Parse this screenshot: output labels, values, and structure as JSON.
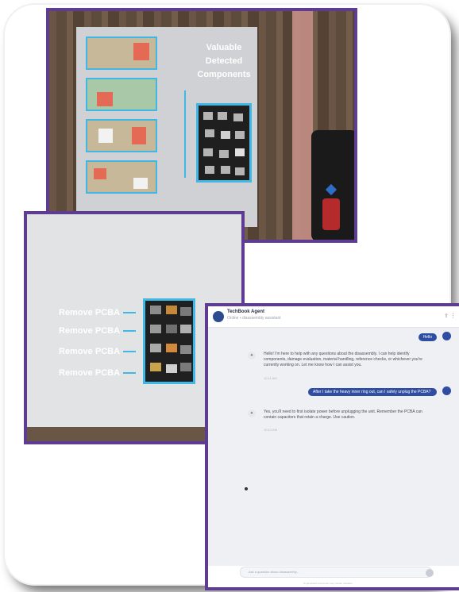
{
  "top_panel": {
    "overlay_title_lines": [
      "Valuable",
      "Detected",
      "Components"
    ]
  },
  "pcba_panel": {
    "labels": [
      "Remove PCBA",
      "Remove PCBA",
      "Remove PCBA",
      "Remove PCBA"
    ]
  },
  "chat": {
    "agent_name": "TechBook Agent",
    "agent_subtitle": "Online • disassembly assistant",
    "header_icons": [
      "share-icon",
      "more-icon"
    ],
    "messages": [
      {
        "role": "user",
        "text": "Hello",
        "time": ""
      },
      {
        "role": "agent",
        "text": "Hello! I'm here to help with any questions about the disassembly. I can help identify components, damage evaluation, material handling, reference checks, or whichever you're currently working on. Let me know how I can assist you.",
        "time": "10:11 AM"
      },
      {
        "role": "user",
        "text": "After I take the heavy inner ring out, can I safely unplug the PCBA?",
        "time": ""
      },
      {
        "role": "agent",
        "text": "Yes, you'll need to first isolate power before unplugging the unit. Remember the PCBA can contain capacitors that retain a charge. Use caution.",
        "time": "10:12 AM"
      }
    ],
    "input_placeholder": "Ask a question about disassembly...",
    "footer_text": "AI-generated responses may contain mistakes"
  },
  "colors": {
    "frame_purple": "#5e3c92",
    "detection_blue": "#3fb8e6",
    "user_bubble": "#2f4ea1"
  }
}
